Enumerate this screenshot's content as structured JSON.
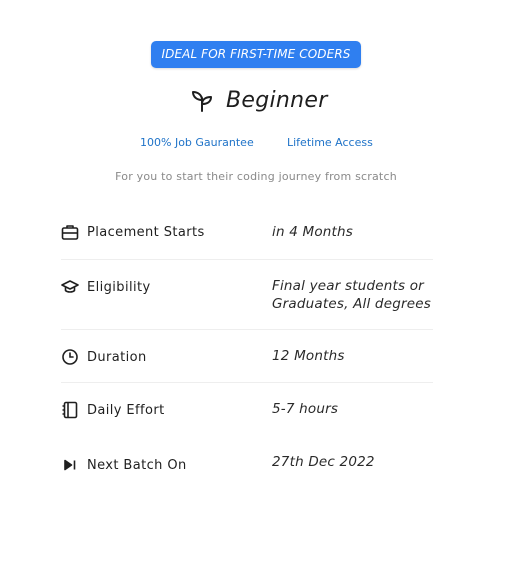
{
  "badge": "IDEAL FOR FIRST-TIME CODERS",
  "title": "Beginner",
  "title_icon": "sprout-icon",
  "perks": [
    "100% Job Gaurantee",
    "Lifetime Access"
  ],
  "subtitle": "For you to start their coding journey from scratch",
  "rows": [
    {
      "icon": "briefcase-icon",
      "label": "Placement Starts",
      "value_lines": [
        "in 4 Months"
      ]
    },
    {
      "icon": "graduation-cap-icon",
      "label": "Eligibility",
      "value_lines": [
        "Final year students or",
        "Graduates, All degrees"
      ]
    },
    {
      "icon": "clock-icon",
      "label": "Duration",
      "value_lines": [
        "12 Months"
      ]
    },
    {
      "icon": "notebook-icon",
      "label": "Daily Effort",
      "value_lines": [
        "5-7 hours"
      ]
    },
    {
      "icon": "skip-next-icon",
      "label": "Next Batch On",
      "value_lines": [
        "27th Dec 2022"
      ]
    }
  ],
  "colors": {
    "badge_bg": "#2f7ff0",
    "perk_text": "#1f73c8",
    "subtitle_text": "#8a8a8a"
  }
}
